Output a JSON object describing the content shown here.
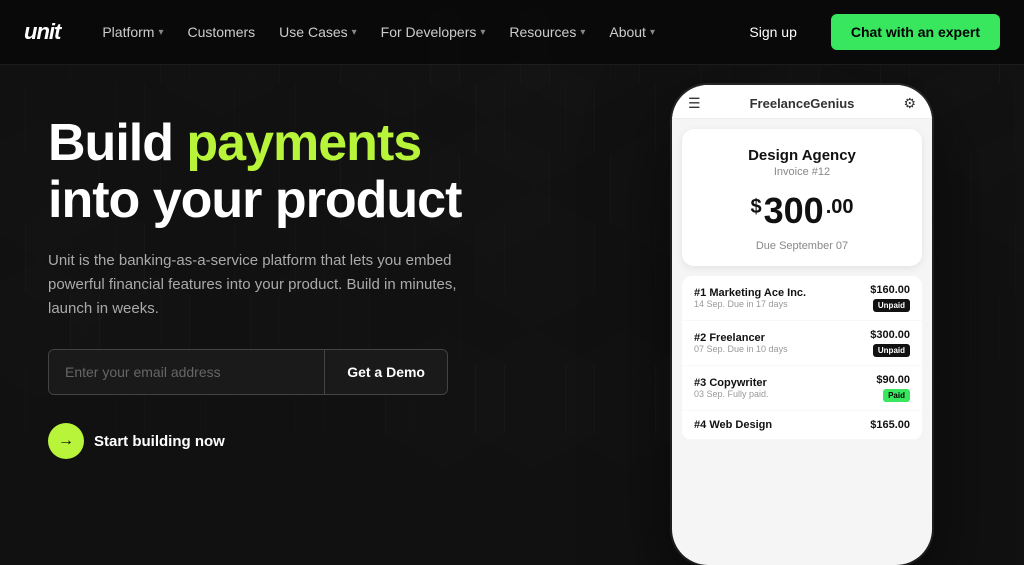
{
  "logo": "unit",
  "navbar": {
    "items": [
      {
        "label": "Platform",
        "hasDropdown": true
      },
      {
        "label": "Customers",
        "hasDropdown": false
      },
      {
        "label": "Use Cases",
        "hasDropdown": true
      },
      {
        "label": "For Developers",
        "hasDropdown": true
      },
      {
        "label": "Resources",
        "hasDropdown": true
      },
      {
        "label": "About",
        "hasDropdown": true
      }
    ],
    "signup_label": "Sign up",
    "chat_label": "Chat with an expert"
  },
  "hero": {
    "title_line1": "Build ",
    "title_highlight": "payments",
    "title_line2": "into your product",
    "subtitle": "Unit is the banking-as-a-service platform that lets you embed powerful financial features into your product. Build in minutes, launch in weeks.",
    "email_placeholder": "Enter your email address",
    "demo_button": "Get a Demo",
    "start_label": "Start building now"
  },
  "phone": {
    "app_name": "FreelanceGenius",
    "invoice": {
      "company": "Design Agency",
      "number": "Invoice #12",
      "amount_whole": "300",
      "amount_cents": ".00",
      "amount_symbol": "$",
      "due": "Due September 07"
    },
    "list_items": [
      {
        "rank": "#1",
        "name": "Marketing Ace Inc.",
        "date": "14 Sep. Due in 17 days",
        "amount": "$160.00",
        "badge": "Unpaid",
        "badge_type": "unpaid"
      },
      {
        "rank": "#2",
        "name": "Freelancer",
        "date": "07 Sep. Due in 10 days",
        "amount": "$300.00",
        "badge": "Unpaid",
        "badge_type": "unpaid"
      },
      {
        "rank": "#3",
        "name": "Copywriter",
        "date": "03 Sep. Fully paid.",
        "amount": "$90.00",
        "badge": "Paid",
        "badge_type": "paid"
      },
      {
        "rank": "#4",
        "name": "Web Design",
        "date": "",
        "amount": "$165.00",
        "badge": "",
        "badge_type": ""
      }
    ]
  }
}
